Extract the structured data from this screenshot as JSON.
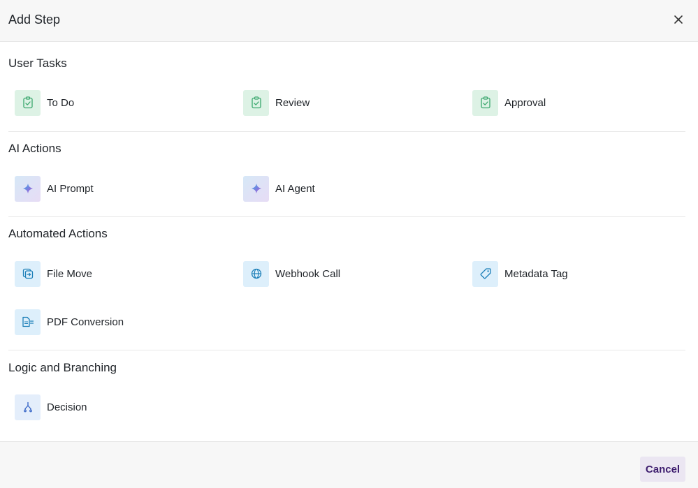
{
  "dialog": {
    "title": "Add Step",
    "cancel_label": "Cancel"
  },
  "sections": [
    {
      "title": "User Tasks",
      "items": [
        {
          "label": "To Do",
          "icon": "clipboard-check-icon"
        },
        {
          "label": "Review",
          "icon": "clipboard-check-icon"
        },
        {
          "label": "Approval",
          "icon": "clipboard-check-icon"
        }
      ]
    },
    {
      "title": "AI Actions",
      "items": [
        {
          "label": "AI Prompt",
          "icon": "sparkle-icon"
        },
        {
          "label": "AI Agent",
          "icon": "sparkle-icon"
        }
      ]
    },
    {
      "title": "Automated Actions",
      "items": [
        {
          "label": "File Move",
          "icon": "file-move-icon"
        },
        {
          "label": "Webhook Call",
          "icon": "globe-icon"
        },
        {
          "label": "Metadata Tag",
          "icon": "tag-icon"
        },
        {
          "label": "PDF Conversion",
          "icon": "file-convert-icon"
        }
      ]
    },
    {
      "title": "Logic and Branching",
      "items": [
        {
          "label": "Decision",
          "icon": "branch-icon"
        }
      ]
    }
  ],
  "colors": {
    "user_task_tile": "#ddf2e5",
    "user_task_icon": "#3aa76d",
    "automated_tile": "#ddeffb",
    "automated_icon": "#1c7fb8",
    "decision_icon": "#2f5fc4",
    "cancel_text": "#3d1c6e",
    "cancel_bg": "#ebe6f2"
  }
}
